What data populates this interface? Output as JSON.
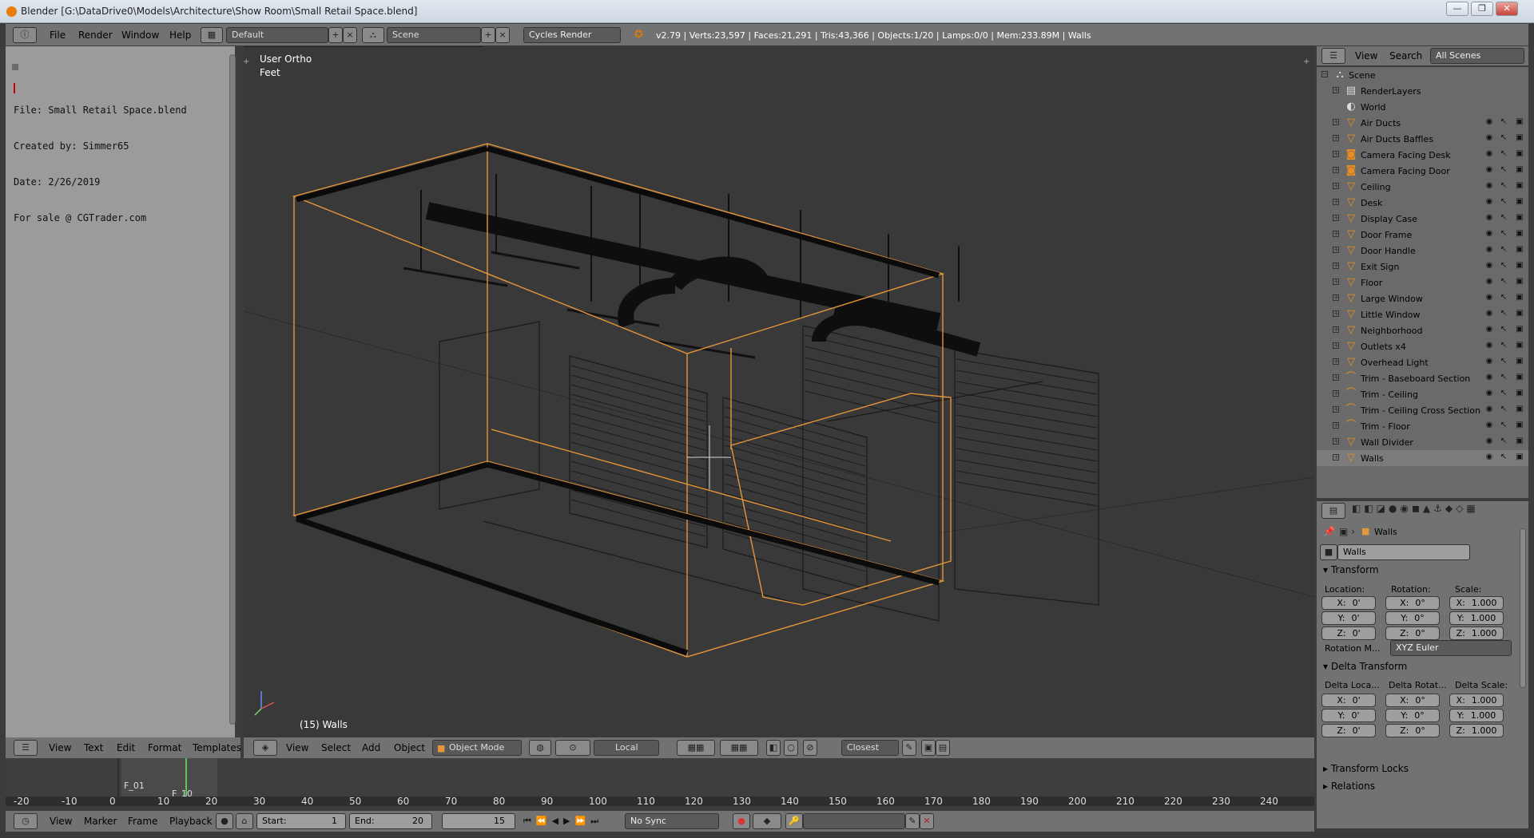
{
  "window": {
    "title": "Blender [G:\\DataDrive0\\Models\\Architecture\\Show Room\\Small Retail Space.blend]",
    "minimize": "—",
    "maximize": "❐",
    "close": "✕"
  },
  "info_header": {
    "menus": [
      "File",
      "Render",
      "Window",
      "Help"
    ],
    "layout": "Default",
    "scene": "Scene",
    "engine": "Cycles Render",
    "stats": "v2.79 | Verts:23,597 | Faces:21,291 | Tris:43,366 | Objects:1/20 | Lamps:0/0 | Mem:233.89M | Walls"
  },
  "text_editor": {
    "lines": [
      "File: Small Retail Space.blend",
      "Created by: Simmer65",
      "Date: 2/26/2019",
      "For sale @ CGTrader.com"
    ],
    "menus": [
      "View",
      "Text",
      "Edit",
      "Format",
      "Templates"
    ]
  },
  "viewport": {
    "view_name": "User Ortho",
    "units": "Feet",
    "object_label": "(15) Walls",
    "menus": [
      "View",
      "Select",
      "Add",
      "Object"
    ],
    "mode": "Object Mode",
    "pivot": "Local",
    "snap": "Closest"
  },
  "outliner": {
    "menus": [
      "View",
      "Search"
    ],
    "filter": "All Scenes",
    "scene": "Scene",
    "items": [
      {
        "label": "RenderLayers",
        "icon": "renderlayers-icon"
      },
      {
        "label": "World",
        "icon": "world-icon"
      },
      {
        "label": "Air Ducts",
        "icon": "mesh-icon"
      },
      {
        "label": "Air Ducts Baffles",
        "icon": "mesh-icon"
      },
      {
        "label": "Camera Facing Desk",
        "icon": "camera-icon"
      },
      {
        "label": "Camera Facing Door",
        "icon": "camera-icon"
      },
      {
        "label": "Ceiling",
        "icon": "mesh-icon"
      },
      {
        "label": "Desk",
        "icon": "mesh-icon"
      },
      {
        "label": "Display Case",
        "icon": "mesh-icon"
      },
      {
        "label": "Door Frame",
        "icon": "mesh-icon"
      },
      {
        "label": "Door Handle",
        "icon": "mesh-icon"
      },
      {
        "label": "Exit Sign",
        "icon": "mesh-icon"
      },
      {
        "label": "Floor",
        "icon": "mesh-icon"
      },
      {
        "label": "Large Window",
        "icon": "mesh-icon"
      },
      {
        "label": "Little Window",
        "icon": "mesh-icon"
      },
      {
        "label": "Neighborhood",
        "icon": "mesh-icon"
      },
      {
        "label": "Outlets x4",
        "icon": "mesh-icon"
      },
      {
        "label": "Overhead Light",
        "icon": "mesh-icon"
      },
      {
        "label": "Trim - Baseboard Section",
        "icon": "curve-icon"
      },
      {
        "label": "Trim - Ceiling",
        "icon": "curve-icon"
      },
      {
        "label": "Trim - Ceiling Cross Section",
        "icon": "curve-icon"
      },
      {
        "label": "Trim - Floor",
        "icon": "curve-icon"
      },
      {
        "label": "Wall Divider",
        "icon": "mesh-icon"
      },
      {
        "label": "Walls",
        "icon": "mesh-icon"
      }
    ]
  },
  "properties": {
    "breadcrumb": "Walls",
    "object_name": "Walls",
    "transform": {
      "title": "Transform",
      "location_label": "Location:",
      "rotation_label": "Rotation:",
      "scale_label": "Scale:",
      "location": [
        "X:",
        "0'",
        "Y:",
        "0'",
        "Z:",
        "0'"
      ],
      "rotation": [
        "X:",
        "0°",
        "Y:",
        "0°",
        "Z:",
        "0°"
      ],
      "scale": [
        "X:",
        "1.000",
        "Y:",
        "1.000",
        "Z:",
        "1.000"
      ],
      "rotation_mode_label": "Rotation M...",
      "rotation_mode": "XYZ Euler"
    },
    "delta": {
      "title": "Delta Transform",
      "location_label": "Delta Loca...",
      "rotation_label": "Delta Rotat...",
      "scale_label": "Delta Scale:",
      "location": [
        "X:",
        "0'",
        "Y:",
        "0'",
        "Z:",
        "0'"
      ],
      "rotation": [
        "X:",
        "0°",
        "Y:",
        "0°",
        "Z:",
        "0°"
      ],
      "scale": [
        "X:",
        "1.000",
        "Y:",
        "1.000",
        "Z:",
        "1.000"
      ]
    },
    "collapsed": [
      "Transform Locks",
      "Relations"
    ]
  },
  "timeline": {
    "ticks": [
      "-20",
      "-10",
      "0",
      "10",
      "20",
      "30",
      "40",
      "50",
      "60",
      "70",
      "80",
      "90",
      "100",
      "110",
      "120",
      "130",
      "140",
      "150",
      "160",
      "170",
      "180",
      "190",
      "200",
      "210",
      "220",
      "230",
      "240"
    ],
    "markers": [
      "F_01",
      "F_10"
    ],
    "menus": [
      "View",
      "Marker",
      "Frame",
      "Playback"
    ],
    "start_label": "Start:",
    "start": "1",
    "end_label": "End:",
    "end": "20",
    "current": "15",
    "sync": "No Sync"
  }
}
